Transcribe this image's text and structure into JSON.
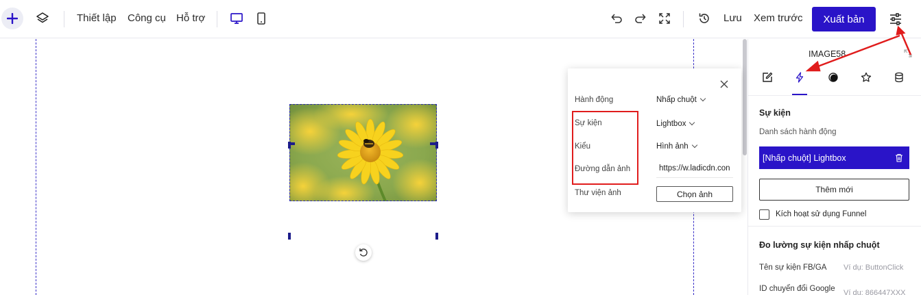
{
  "toolbar": {
    "menu": [
      "Thiết lập",
      "Công cụ",
      "Hỗ trợ"
    ],
    "save_label": "Lưu",
    "preview_label": "Xem trước",
    "publish_label": "Xuất bản"
  },
  "popup": {
    "rows": [
      {
        "label": "Hành động",
        "value": "Nhấp chuột"
      },
      {
        "label": "Sự kiện",
        "value": "Lightbox"
      },
      {
        "label": "Kiểu",
        "value": "Hình ảnh"
      },
      {
        "label": "Đường dẫn ảnh",
        "value": "https://w.ladicdn.con"
      },
      {
        "label": "Thư viện ảnh",
        "value": "Chọn ảnh"
      }
    ]
  },
  "panel": {
    "element_name": "IMAGE58",
    "section_title": "Sự kiện",
    "action_list_label": "Danh sách hành động",
    "action_item": "[Nhấp chuột] Lightbox",
    "add_new_label": "Thêm mới",
    "funnel_label": "Kích hoạt sử dụng Funnel",
    "tracking_title": "Đo lường sự kiện nhấp chuột",
    "fields": [
      {
        "label": "Tên sự kiện FB/GA",
        "placeholder": "Ví dụ: ButtonClick"
      },
      {
        "label": "ID chuyển đổi Google",
        "placeholder": "Ví dụ: 866447XXX"
      }
    ]
  },
  "colors": {
    "accent": "#2a14c8",
    "highlight_red": "#e01c1c"
  }
}
